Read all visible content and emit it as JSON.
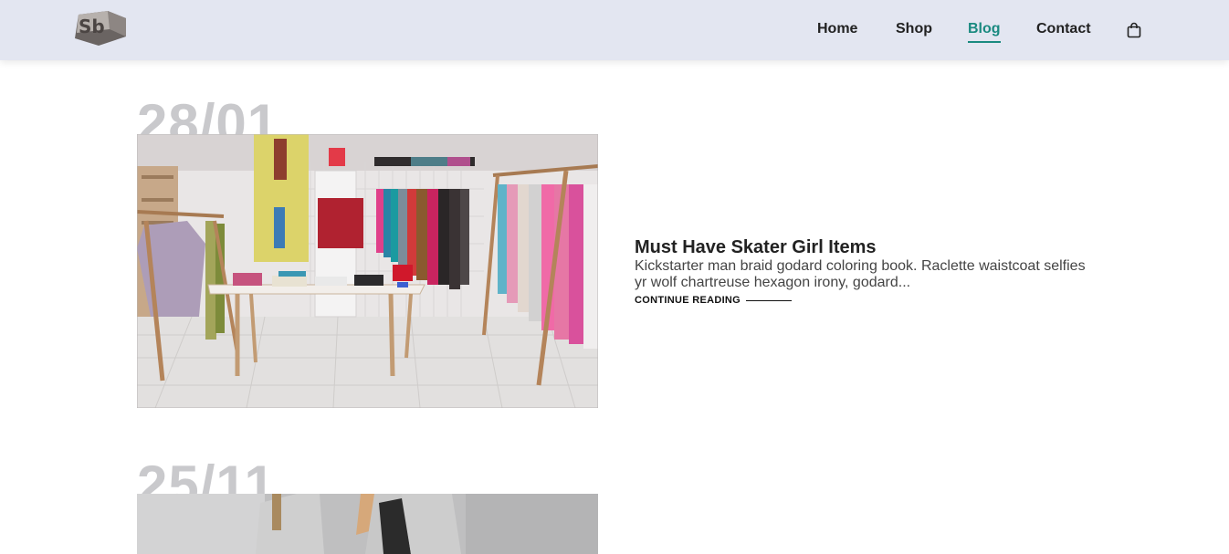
{
  "header": {
    "logo_text": "Sb",
    "nav": [
      {
        "label": "Home"
      },
      {
        "label": "Shop"
      },
      {
        "label": "Blog",
        "active": true
      },
      {
        "label": "Contact"
      }
    ],
    "cart_icon": "shopping-bag-icon",
    "accent_color": "#1a8a80"
  },
  "posts": [
    {
      "date": "28/01",
      "title": "Must Have Skater Girl Items",
      "excerpt": "Kickstarter man braid godard coloring book. Raclette waistcoat selfies yr wolf chartreuse hexagon irony, godard...",
      "cta": "CONTINUE READING"
    },
    {
      "date": "25/11"
    }
  ]
}
